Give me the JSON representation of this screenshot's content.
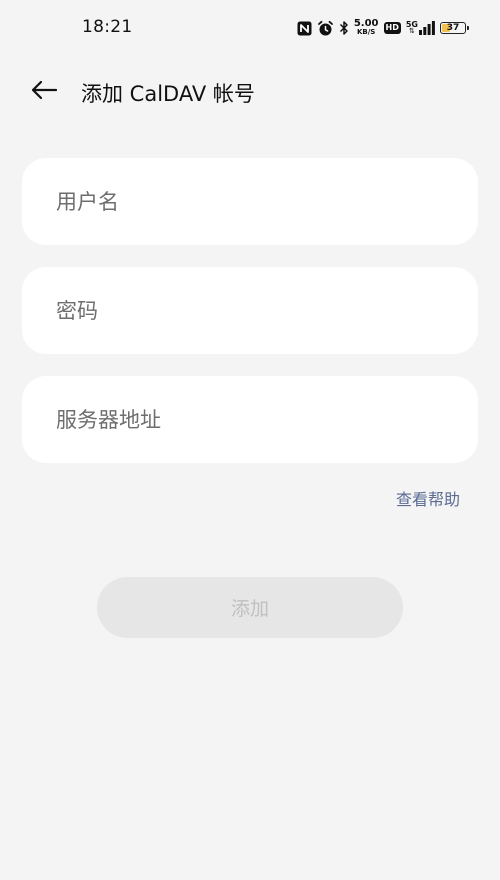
{
  "status_bar": {
    "time": "18:21",
    "net_speed_value": "5.00",
    "net_speed_unit": "KB/S",
    "hd_label": "HD",
    "network_type": "5G",
    "battery_level": "37",
    "battery_fraction": 0.37,
    "battery_color": "#f2c04e",
    "icons": [
      "nfc-icon",
      "alarm-icon",
      "bluetooth-icon",
      "hd-badge",
      "signal-icon",
      "battery-icon"
    ]
  },
  "header": {
    "back_icon": "arrow-left-icon",
    "title": "添加 CalDAV 帐号"
  },
  "form": {
    "username": {
      "placeholder": "用户名",
      "value": ""
    },
    "password": {
      "placeholder": "密码",
      "value": ""
    },
    "server": {
      "placeholder": "服务器地址",
      "value": ""
    }
  },
  "help_link": "查看帮助",
  "add_button": {
    "label": "添加",
    "disabled": true
  },
  "colors": {
    "background": "#f4f4f4",
    "field_background": "#ffffff",
    "link": "#5b6b94",
    "button_disabled_bg": "#e6e6e6",
    "button_disabled_text": "#c0c0c0"
  }
}
